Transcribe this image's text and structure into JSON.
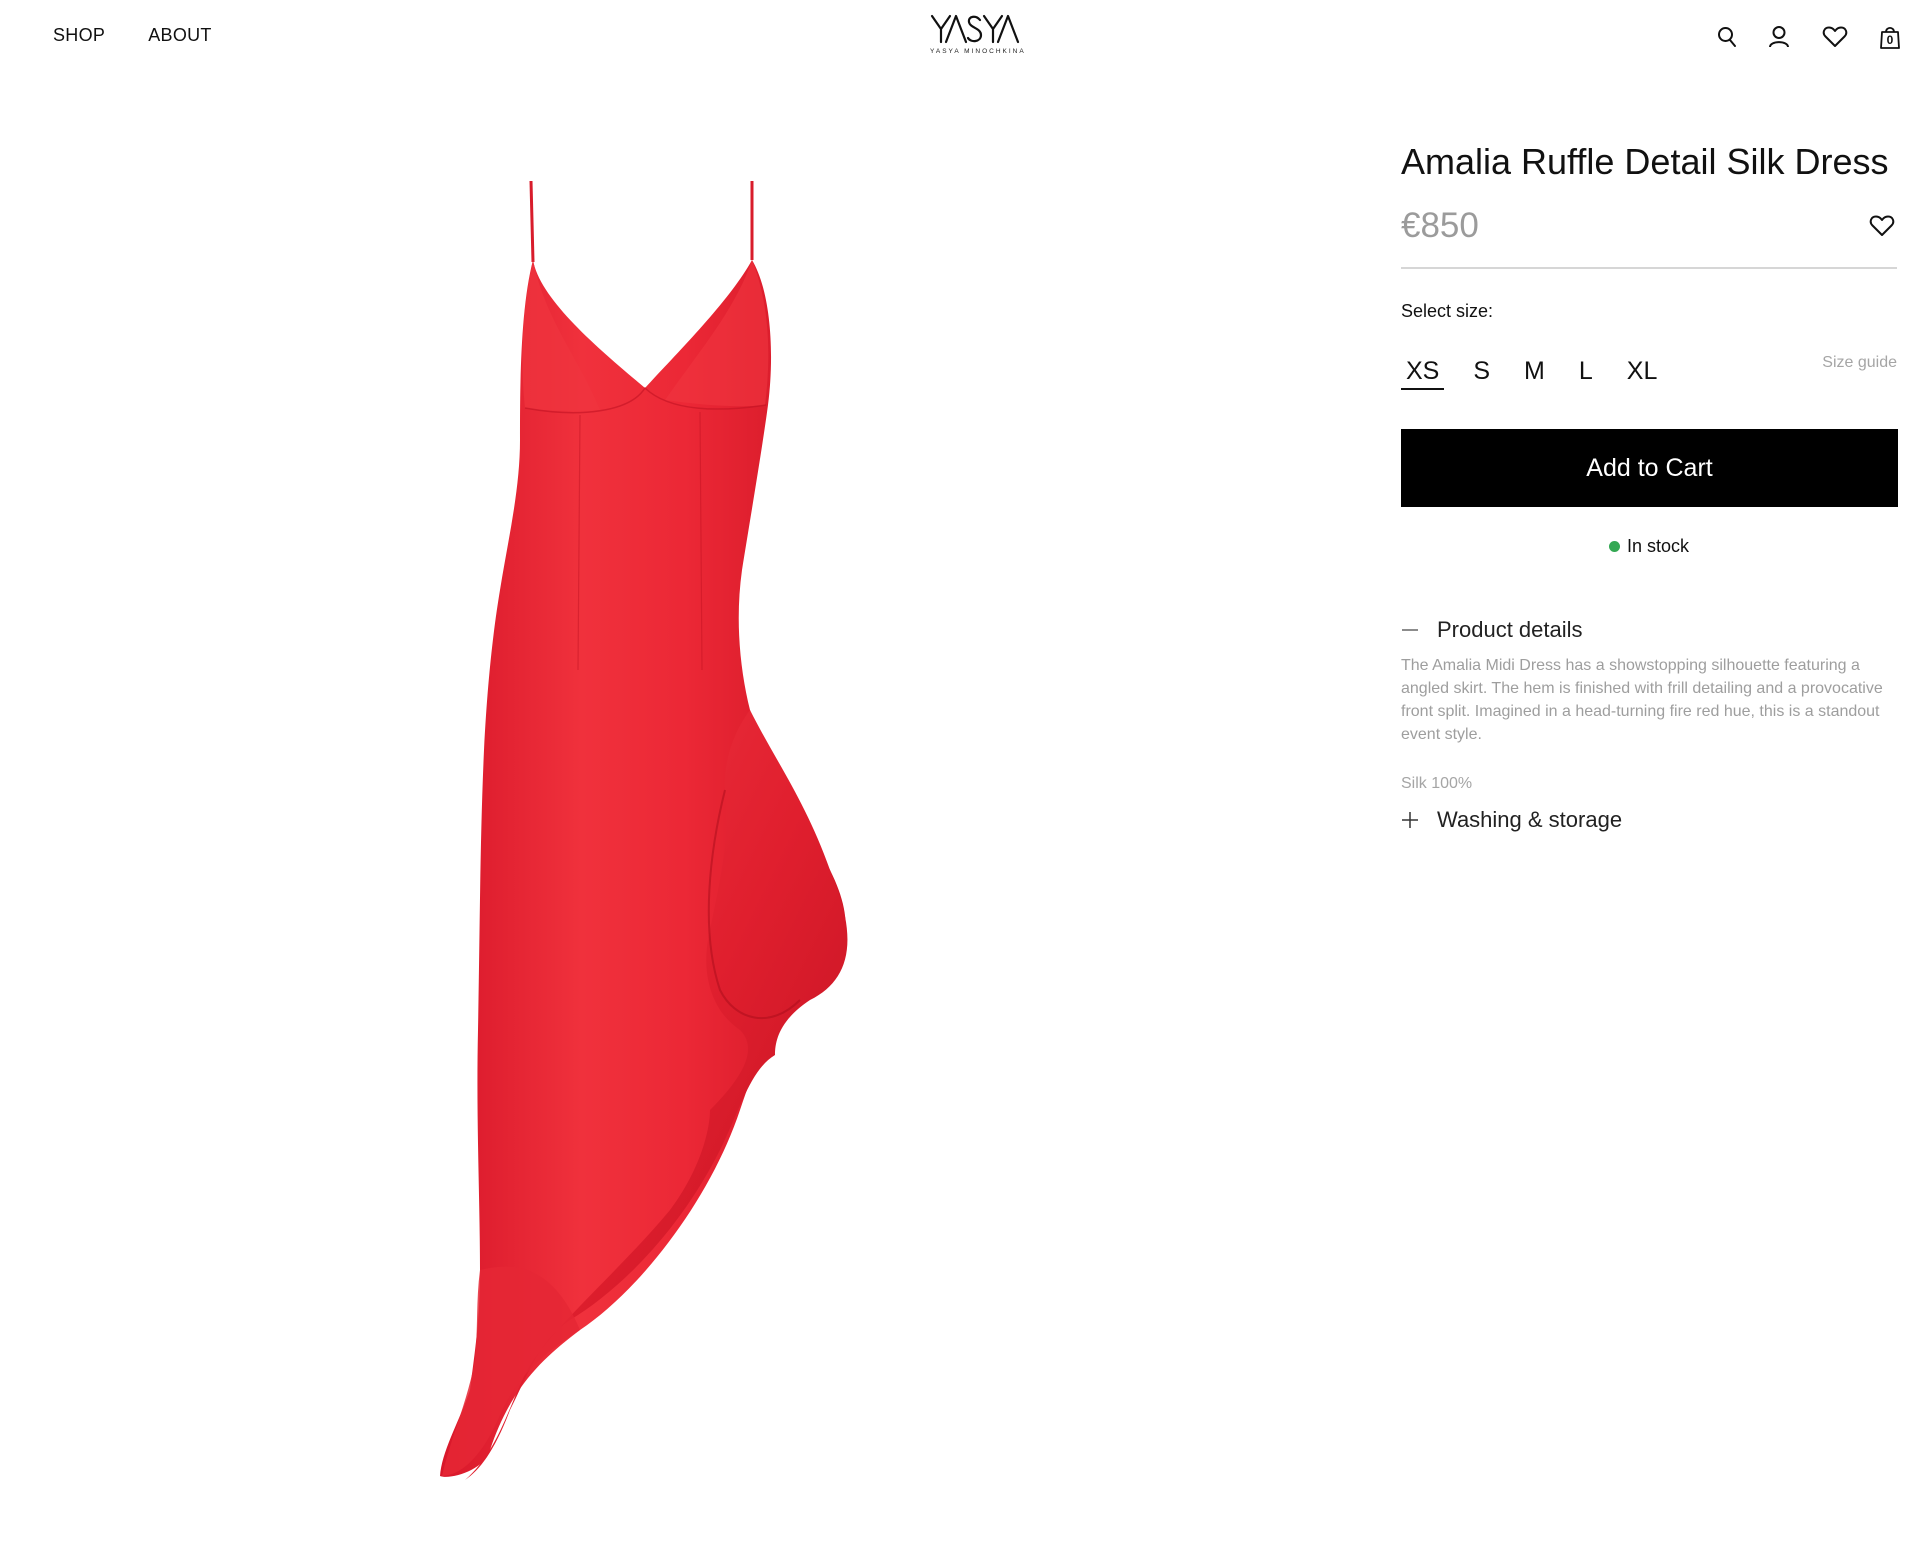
{
  "header": {
    "nav": [
      {
        "label": "SHOP"
      },
      {
        "label": "ABOUT"
      }
    ],
    "logo": {
      "mark": "YASYA",
      "subtitle": "YASYA MINOCHKINA"
    },
    "icons": [
      "search-icon",
      "account-icon",
      "wishlist-icon",
      "cart-icon"
    ],
    "cart_count": "0"
  },
  "product": {
    "title": "Amalia Ruffle Detail Silk Dress",
    "price": "€850",
    "select_size_label": "Select size:",
    "sizes": [
      "XS",
      "S",
      "M",
      "L",
      "XL"
    ],
    "selected_size": "XS",
    "size_guide_label": "Size guide",
    "add_to_cart_label": "Add to Cart",
    "stock_status": "In stock",
    "stock_color": "#33a853",
    "image_color": "#e8232f",
    "accordions": {
      "details": {
        "label": "Product details",
        "expanded": true,
        "text": "The Amalia Midi Dress has a showstopping silhouette featuring a angled skirt. The hem is finished with frill detailing and a provocative front split. Imagined in a head-turning fire red hue, this is a standout event style.",
        "material": "Silk 100%"
      },
      "washing": {
        "label": "Washing & storage",
        "expanded": false
      }
    }
  }
}
